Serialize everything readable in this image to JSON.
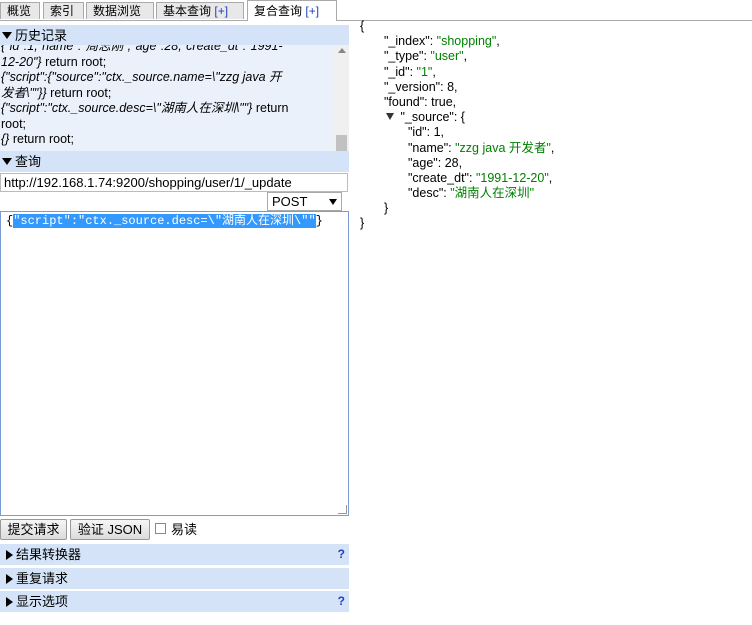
{
  "tabs": [
    {
      "label": "概览",
      "plus": ""
    },
    {
      "label": "索引",
      "plus": ""
    },
    {
      "label": "数据浏览",
      "plus": ""
    },
    {
      "label": "基本查询",
      "plus": "[+]"
    },
    {
      "label": "复合查询",
      "plus": "[+]",
      "active": true
    }
  ],
  "history": {
    "title": "历史记录",
    "lines": [
      {
        "italic": "{\"id\":1,\"name\":\"周志刚\",\"age\":28,\"create_dt\":\"1991-",
        "plain": ""
      },
      {
        "italic": "12-20\"}",
        "plain": " return root;"
      },
      {
        "italic": "{\"script\":{\"source\":\"ctx._source.name=\\\"zzg java 开",
        "plain": ""
      },
      {
        "italic": "发者\\\"\"}}",
        "plain": " return root;"
      },
      {
        "italic": "{\"script\":\"ctx._source.desc=\\\"湖南人在深圳\\\"\"}",
        "plain": " return"
      },
      {
        "italic": "",
        "plain": "root;"
      },
      {
        "italic": "{}",
        "plain": " return root;"
      }
    ]
  },
  "query": {
    "title": "查询",
    "url": "http://192.168.1.74:9200/shopping/user/1/_update",
    "method": "POST",
    "body_prefix": "{",
    "body_selected": "\"script\":\"ctx._source.desc=\\\"湖南人在深圳\\\"\"",
    "body_suffix": "}"
  },
  "buttons": {
    "submit": "提交请求",
    "validate": "验证 JSON",
    "readable": "易读"
  },
  "sections": [
    {
      "label": "结果转换器",
      "help": "?"
    },
    {
      "label": "重复请求",
      "help": ""
    },
    {
      "label": "显示选项",
      "help": "?"
    }
  ],
  "response": {
    "open": "{",
    "index_key": "\"_index\"",
    "index_val": "\"shopping\"",
    "type_key": "\"_type\"",
    "type_val": "\"user\"",
    "id_key": "\"_id\"",
    "id_val": "\"1\"",
    "version_key": "\"_version\"",
    "version_val": "8",
    "found_key": "\"found\"",
    "found_val": "true",
    "source_key": "\"_source\"",
    "src_id_key": "\"id\"",
    "src_id_val": "1",
    "src_name_key": "\"name\"",
    "src_name_val": "\"zzg java 开发者\"",
    "src_age_key": "\"age\"",
    "src_age_val": "28",
    "src_dt_key": "\"create_dt\"",
    "src_dt_val": "\"1991-12-20\"",
    "src_desc_key": "\"desc\"",
    "src_desc_val": "\"湖南人在深圳\"",
    "inner_close": "}",
    "close": "}"
  },
  "colors": {
    "section_bg": "#d4e3f7",
    "history_bg": "#eaf1fb",
    "string_green": "#008000",
    "plus_blue": "#2040c0",
    "selection_blue": "#3399ff"
  }
}
